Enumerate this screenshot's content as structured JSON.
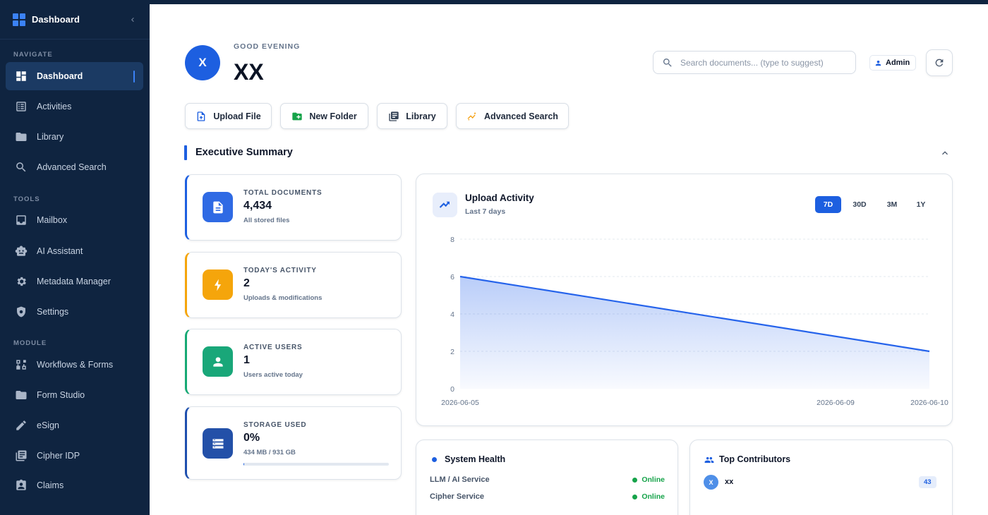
{
  "sidebar": {
    "title": "Dashboard",
    "sections": {
      "navigate": "NAVIGATE",
      "tools": "TOOLS",
      "module": "MODULE"
    },
    "items": [
      {
        "label": "Dashboard",
        "icon": "dashboard-icon",
        "active": true
      },
      {
        "label": "Activities",
        "icon": "activities-icon"
      },
      {
        "label": "Library",
        "icon": "folder-icon"
      },
      {
        "label": "Advanced Search",
        "icon": "search-icon"
      },
      {
        "label": "Mailbox",
        "icon": "inbox-icon"
      },
      {
        "label": "AI Assistant",
        "icon": "robot-icon"
      },
      {
        "label": "Metadata Manager",
        "icon": "gear-icon"
      },
      {
        "label": "Settings",
        "icon": "settings-shield-icon"
      },
      {
        "label": "Workflows & Forms",
        "icon": "workflow-icon"
      },
      {
        "label": "Form Studio",
        "icon": "folder-icon"
      },
      {
        "label": "eSign",
        "icon": "pen-icon"
      },
      {
        "label": "Cipher IDP",
        "icon": "document-stack-icon"
      },
      {
        "label": "Claims",
        "icon": "badge-icon"
      }
    ]
  },
  "header": {
    "avatar_initial": "X",
    "greeting": "GOOD EVENING",
    "user_name": "XX",
    "search_placeholder": "Search documents... (type to suggest)",
    "role_badge": "Admin"
  },
  "actions": {
    "upload_file": "Upload File",
    "new_folder": "New Folder",
    "library": "Library",
    "advanced_search": "Advanced Search"
  },
  "summary": {
    "title": "Executive Summary",
    "stats": [
      {
        "label": "TOTAL DOCUMENTS",
        "value": "4,434",
        "sub": "All stored files",
        "color": "#1d5fe0",
        "icon": "document-icon"
      },
      {
        "label": "TODAY'S ACTIVITY",
        "value": "2",
        "sub": "Uploads & modifications",
        "color": "#f5a50b",
        "icon": "bolt-icon"
      },
      {
        "label": "ACTIVE USERS",
        "value": "1",
        "sub": "Users active today",
        "color": "#16a974",
        "icon": "user-icon"
      },
      {
        "label": "STORAGE USED",
        "value": "0%",
        "sub": "434 MB / 931 GB",
        "color": "#1e4fae",
        "icon": "storage-icon",
        "progress": 0.0005
      }
    ]
  },
  "upload_activity": {
    "title": "Upload Activity",
    "subtitle": "Last 7 days",
    "ranges": [
      "7D",
      "30D",
      "3M",
      "1Y"
    ],
    "active_range": "7D"
  },
  "chart_data": {
    "type": "area",
    "x": [
      "2026-06-05",
      "2026-06-10"
    ],
    "series": [
      {
        "values": [
          6,
          2
        ]
      }
    ],
    "x_tick_labels": [
      "2026-06-05",
      "2026-06-09",
      "2026-06-10"
    ],
    "y_ticks": [
      0,
      2,
      4,
      6,
      8
    ],
    "ylim": [
      0,
      8
    ],
    "grid": true,
    "color": "#2563eb"
  },
  "system_health": {
    "title": "System Health",
    "services": [
      {
        "name": "LLM / AI Service",
        "status": "Online"
      },
      {
        "name": "Cipher Service",
        "status": "Online"
      }
    ]
  },
  "top_contributors": {
    "title": "Top Contributors",
    "items": [
      {
        "initial": "X",
        "name": "xx",
        "count": "43"
      }
    ]
  },
  "colors": {
    "sidebar_bg": "#0f2440",
    "accent": "#1d5fe0",
    "online": "#16a34a"
  }
}
